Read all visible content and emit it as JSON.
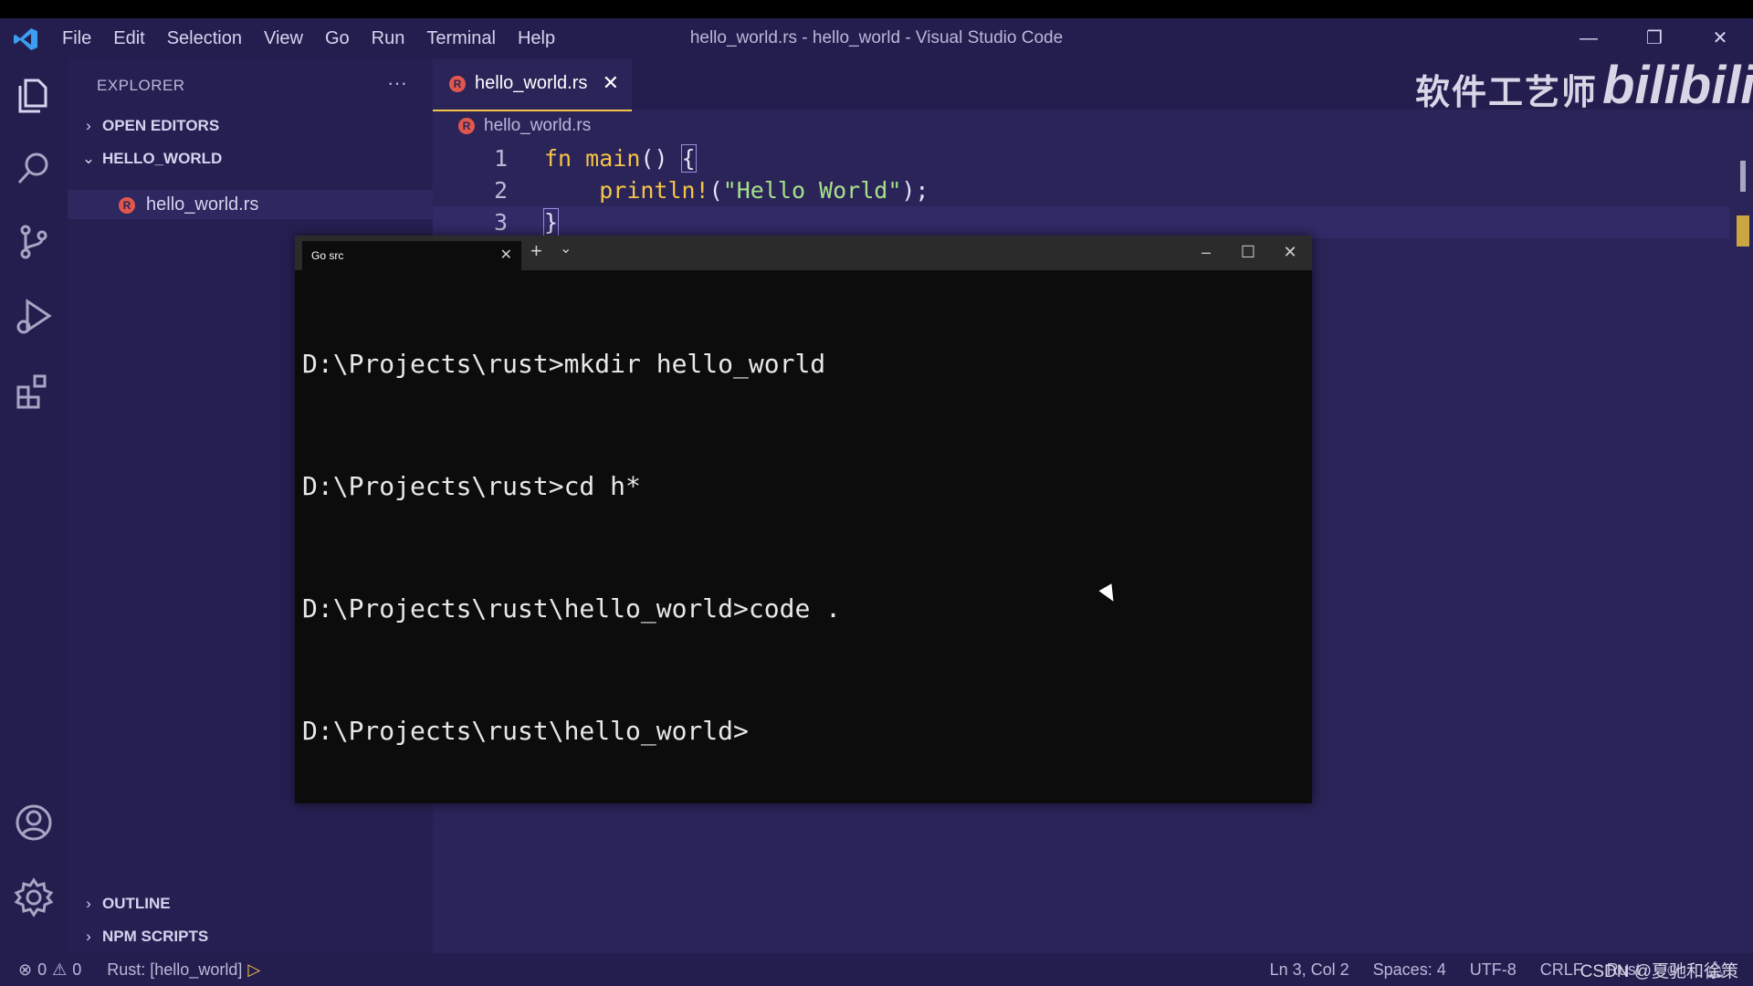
{
  "titlebar": {
    "menu": [
      "File",
      "Edit",
      "Selection",
      "View",
      "Go",
      "Run",
      "Terminal",
      "Help"
    ],
    "window_title": "hello_world.rs - hello_world - Visual Studio Code",
    "controls": {
      "minimize": "—",
      "restore": "❐",
      "close": "✕"
    }
  },
  "watermark": {
    "text": "软件工艺师",
    "brand": "bilibili"
  },
  "sidebar": {
    "title": "EXPLORER",
    "more": "···",
    "sections": {
      "open_editors": "OPEN EDITORS",
      "project": "HELLO_WORLD",
      "outline": "OUTLINE",
      "npm": "NPM SCRIPTS"
    },
    "files": [
      {
        "name": "hello_world.rs",
        "icon": "rust-file-icon"
      }
    ]
  },
  "editor": {
    "tab_label": "hello_world.rs",
    "breadcrumb": "hello_world.rs",
    "lines": [
      {
        "num": "1"
      },
      {
        "num": "2"
      },
      {
        "num": "3"
      }
    ],
    "code": {
      "l1_kw": "fn",
      "l1_name": "main",
      "l1_rest": "() ",
      "l1_brace": "{",
      "l2_macro": "println!",
      "l2_open": "(",
      "l2_str": "\"Hello World\"",
      "l2_close": ");",
      "l3_brace": "}"
    }
  },
  "terminal": {
    "tab_label": "Go src",
    "lines": [
      "D:\\Projects\\rust>mkdir hello_world",
      "D:\\Projects\\rust>cd h*",
      "D:\\Projects\\rust\\hello_world>code .",
      "D:\\Projects\\rust\\hello_world>"
    ]
  },
  "statusbar": {
    "errors": "0",
    "warnings": "0",
    "task": "Rust: [hello_world]",
    "position": "Ln 3, Col 2",
    "spaces": "Spaces: 4",
    "encoding": "UTF-8",
    "eol": "CRLF",
    "language": "Rust"
  },
  "credit": "CSDN @夏驰和徐策",
  "colors": {
    "accent": "#f6c445",
    "background": "#2a2459",
    "terminal_bg": "#0c0c0c",
    "string": "#a8e08a"
  }
}
